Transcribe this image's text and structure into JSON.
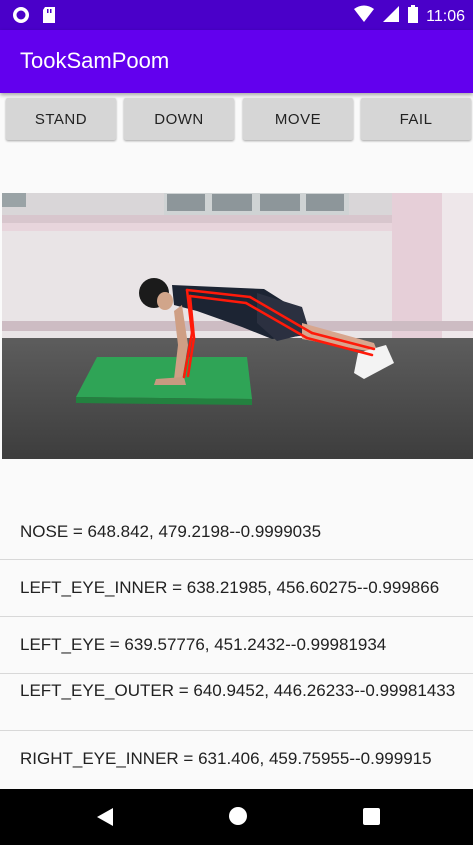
{
  "status": {
    "time": "11:06",
    "colors": {
      "bar": "#4a00c9",
      "icon": "#ffffff"
    }
  },
  "app": {
    "title": "TookSamPoom",
    "colors": {
      "primary": "#6200ee"
    }
  },
  "buttons": {
    "stand": "STAND",
    "down": "DOWN",
    "move": "MOVE",
    "fail": "FAIL"
  },
  "image": {
    "pose_color": "#ff1a0a",
    "mat_color": "#2fa456"
  },
  "landmarks": [
    "NOSE = 648.842, 479.2198--0.9999035",
    "LEFT_EYE_INNER = 638.21985, 456.60275--0.999866",
    "LEFT_EYE = 639.57776, 451.2432--0.99981934",
    "LEFT_EYE_OUTER = 640.9452, 446.26233--0.99981433",
    "RIGHT_EYE_INNER = 631.406, 459.75955--0.999915"
  ],
  "nav": {
    "back": "back-icon",
    "home": "home-icon",
    "recents": "recents-icon"
  }
}
